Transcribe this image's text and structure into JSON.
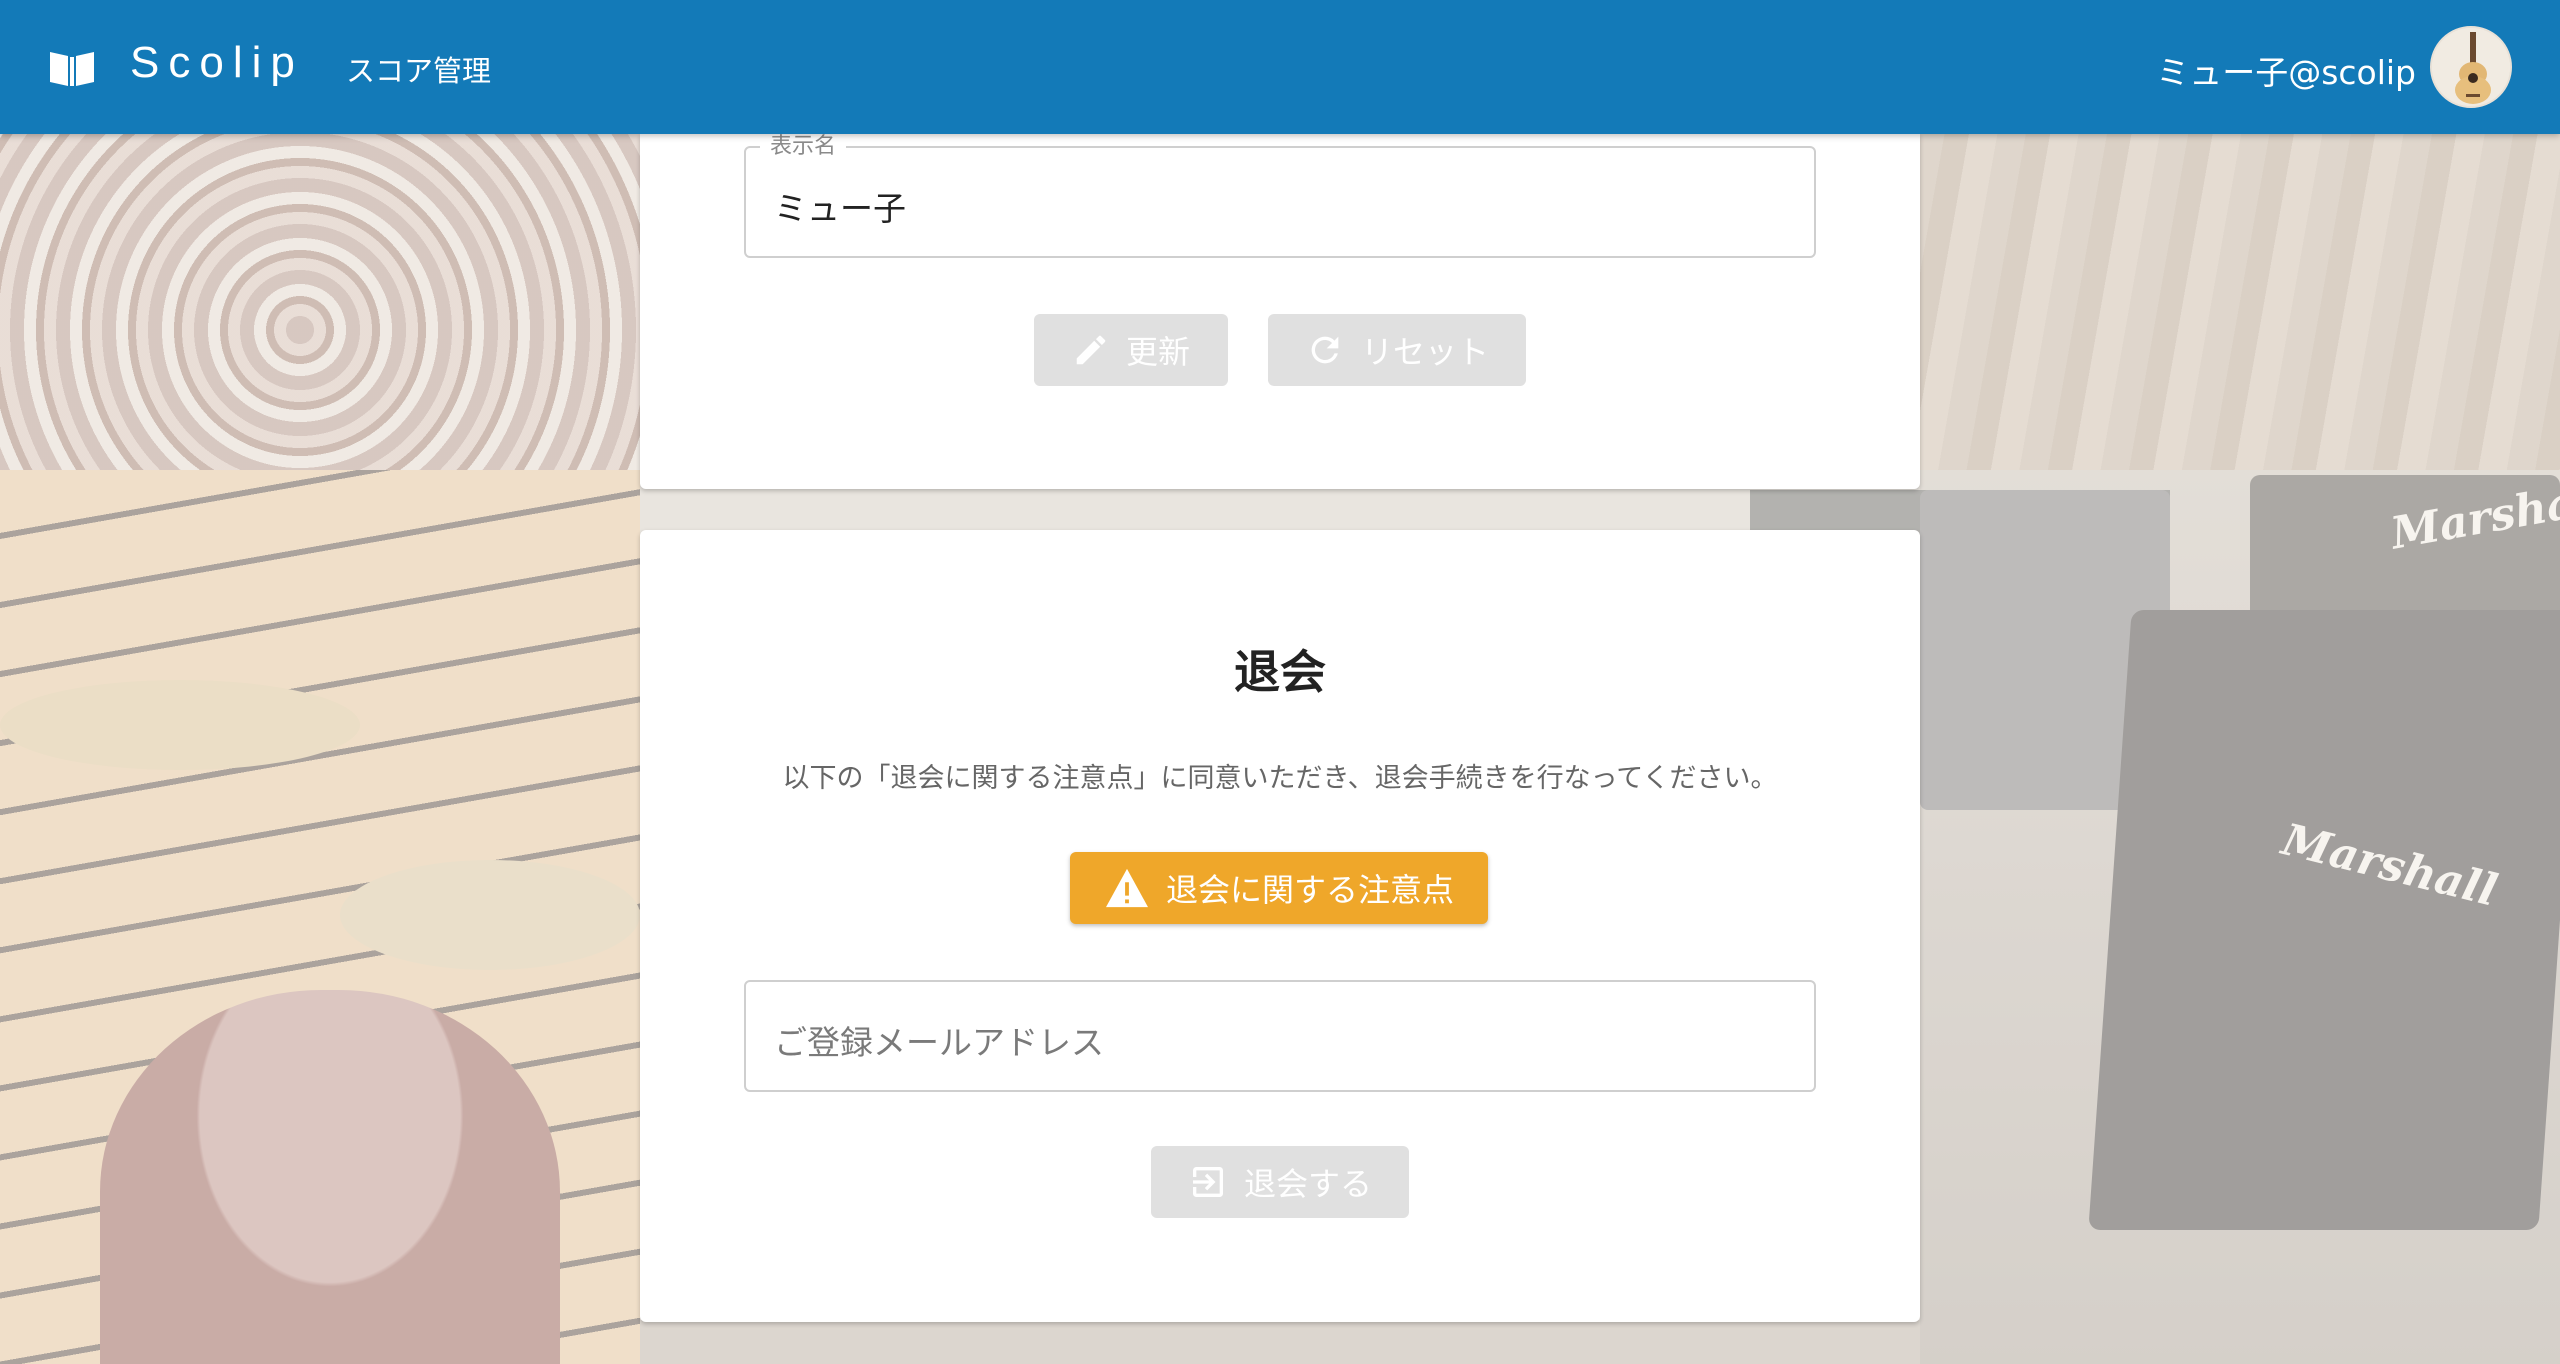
{
  "header": {
    "app_name": "Scolip",
    "nav_score": "スコア管理",
    "user_name": "ミュー子@scolip",
    "colors": {
      "bar": "#137ab8",
      "warning": "#efa72a"
    },
    "icons": {
      "logo": "book-icon",
      "avatar": "guitar-avatar"
    }
  },
  "profile": {
    "display_name_label": "表示名",
    "display_name_value": "ミュー子",
    "update_label": "更新",
    "reset_label": "リセット",
    "icons": {
      "update": "pencil-icon",
      "reset": "refresh-icon"
    }
  },
  "withdraw": {
    "title": "退会",
    "note": "以下の「退会に関する注意点」に同意いただき、退会手続きを行なってください。",
    "warning_button": "退会に関する注意点",
    "email_placeholder": "ご登録メールアドレス",
    "submit_label": "退会する",
    "icons": {
      "warning": "warning-triangle-icon",
      "submit": "exit-icon"
    }
  },
  "background": {
    "brand_top": "Marshall",
    "brand_cab": "Marshall"
  }
}
